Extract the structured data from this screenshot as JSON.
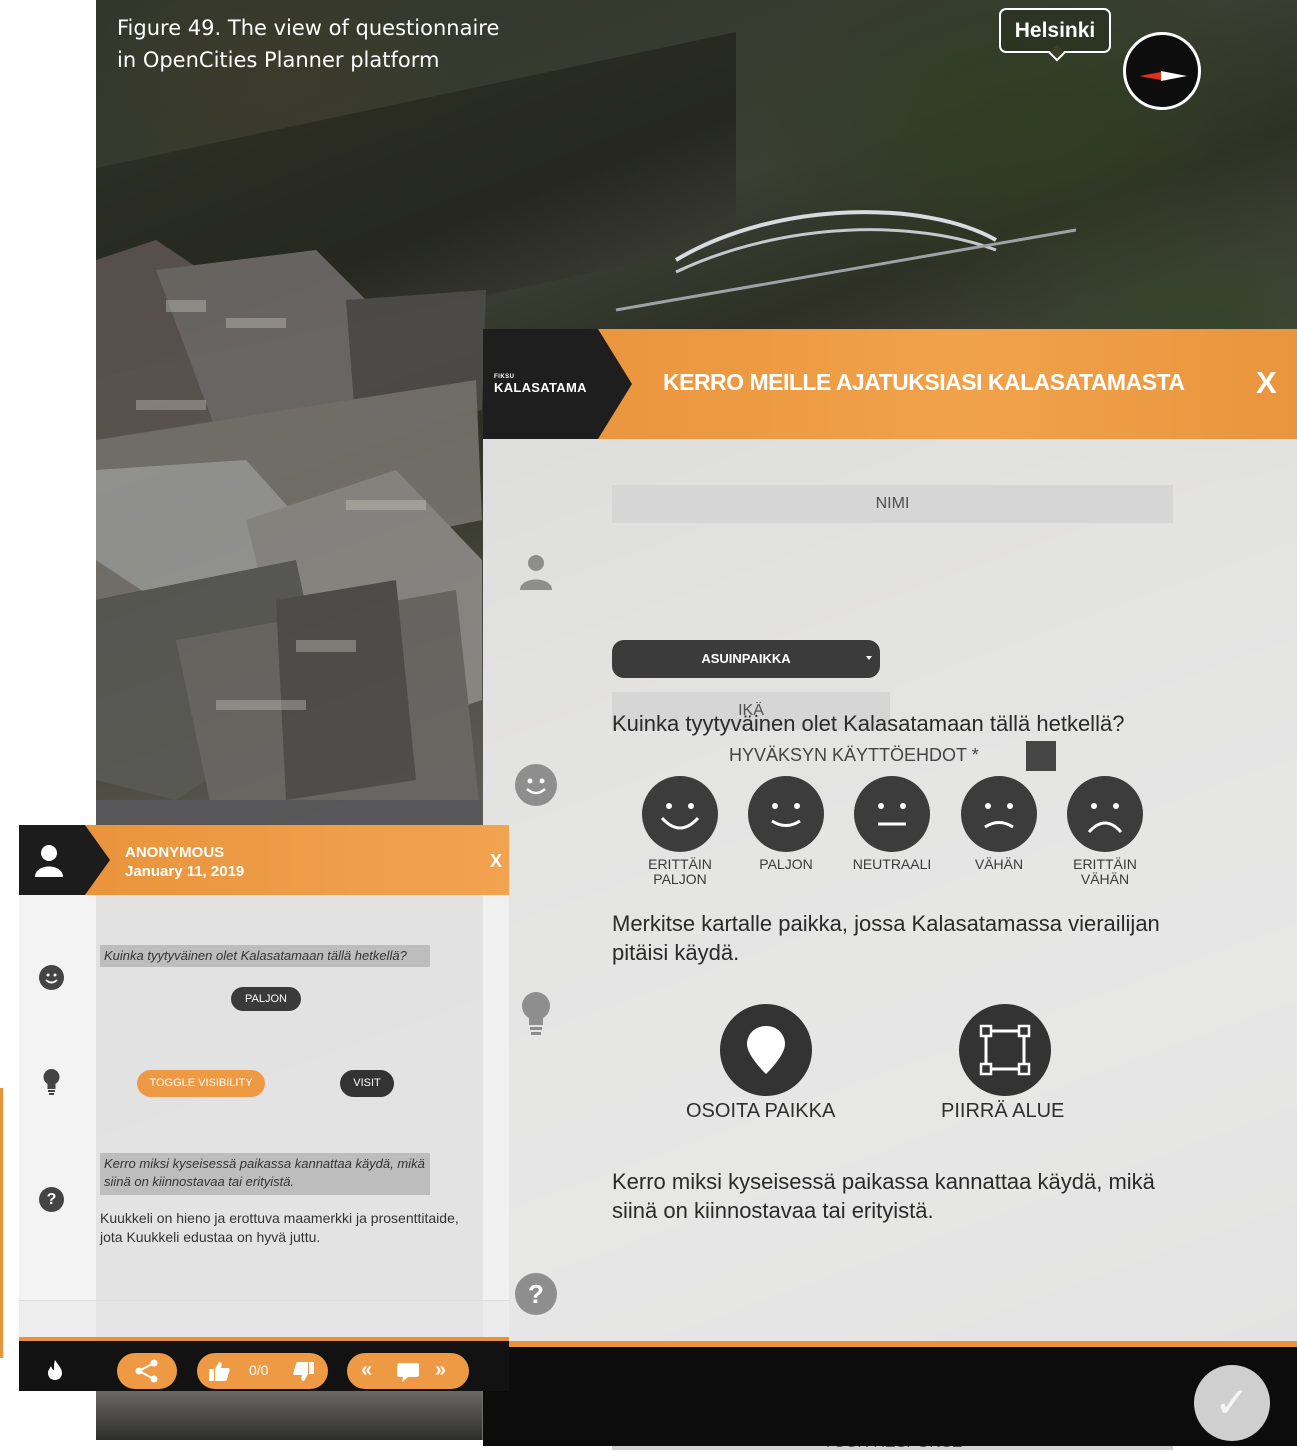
{
  "caption": {
    "line1": "Figure 49. The view of questionnaire",
    "line2": "in OpenCities Planner platform"
  },
  "map": {
    "city_label": "Helsinki",
    "compass_icon": "compass-icon"
  },
  "panel": {
    "logo_small": "FIKSU",
    "logo_text": "KALASATAMA",
    "title": "KERRO MEILLE AJATUKSIASI KALASATAMASTA",
    "close_label": "X",
    "accent_color": "#e8923a",
    "name_placeholder": "NIMI",
    "residence_select": "ASUINPAIKKA",
    "age_placeholder": "IKÄ",
    "terms_label": "HYVÄKSYN KÄYTTÖEHDOT *",
    "q1": "Kuinka tyytyväinen olet Kalasatamaan tällä hetkellä?",
    "satisfaction_options": [
      {
        "label": "ERITTÄIN PALJON",
        "icon": "very-happy-face-icon"
      },
      {
        "label": "PALJON",
        "icon": "happy-face-icon"
      },
      {
        "label": "NEUTRAALI",
        "icon": "neutral-face-icon"
      },
      {
        "label": "VÄHÄN",
        "icon": "sad-face-icon"
      },
      {
        "label": "ERITTÄIN VÄHÄN",
        "icon": "very-sad-face-icon"
      }
    ],
    "q2": "Merkitse kartalle paikka, jossa Kalasatamassa vierailijan pitäisi käydä.",
    "tools": [
      {
        "label": "OSOITA PAIKKA",
        "icon": "map-pin-icon"
      },
      {
        "label": "PIIRRÄ ALUE",
        "icon": "draw-area-icon"
      }
    ],
    "q3": "Kerro miksi kyseisessä paikassa kannattaa käydä, mikä siinä on kiinnostavaa tai erityistä.",
    "response_placeholder": "YOUR RESPONSE",
    "submit_icon": "✓",
    "side_question_mark": "?"
  },
  "card": {
    "user": "ANONYMOUS",
    "date": "January 11, 2019",
    "close_label": "X",
    "q1": "Kuinka tyytyväinen olet Kalasatamaan tällä hetkellä?",
    "answer1": "PALJON",
    "toggle_label": "TOGGLE VISIBILITY",
    "visit_label": "VISIT",
    "q3": "Kerro miksi kyseisessä paikassa kannattaa käydä, mikä siinä on kiinnostavaa tai erityistä.",
    "answer3": "Kuukkeli on hieno ja erottuva maamerkki ja prosenttitaide, jota Kuukkeli edustaa on hyvä juttu.",
    "side_question_mark": "?",
    "vote_count": "0/0",
    "prev_label": "«",
    "next_label": "»"
  }
}
